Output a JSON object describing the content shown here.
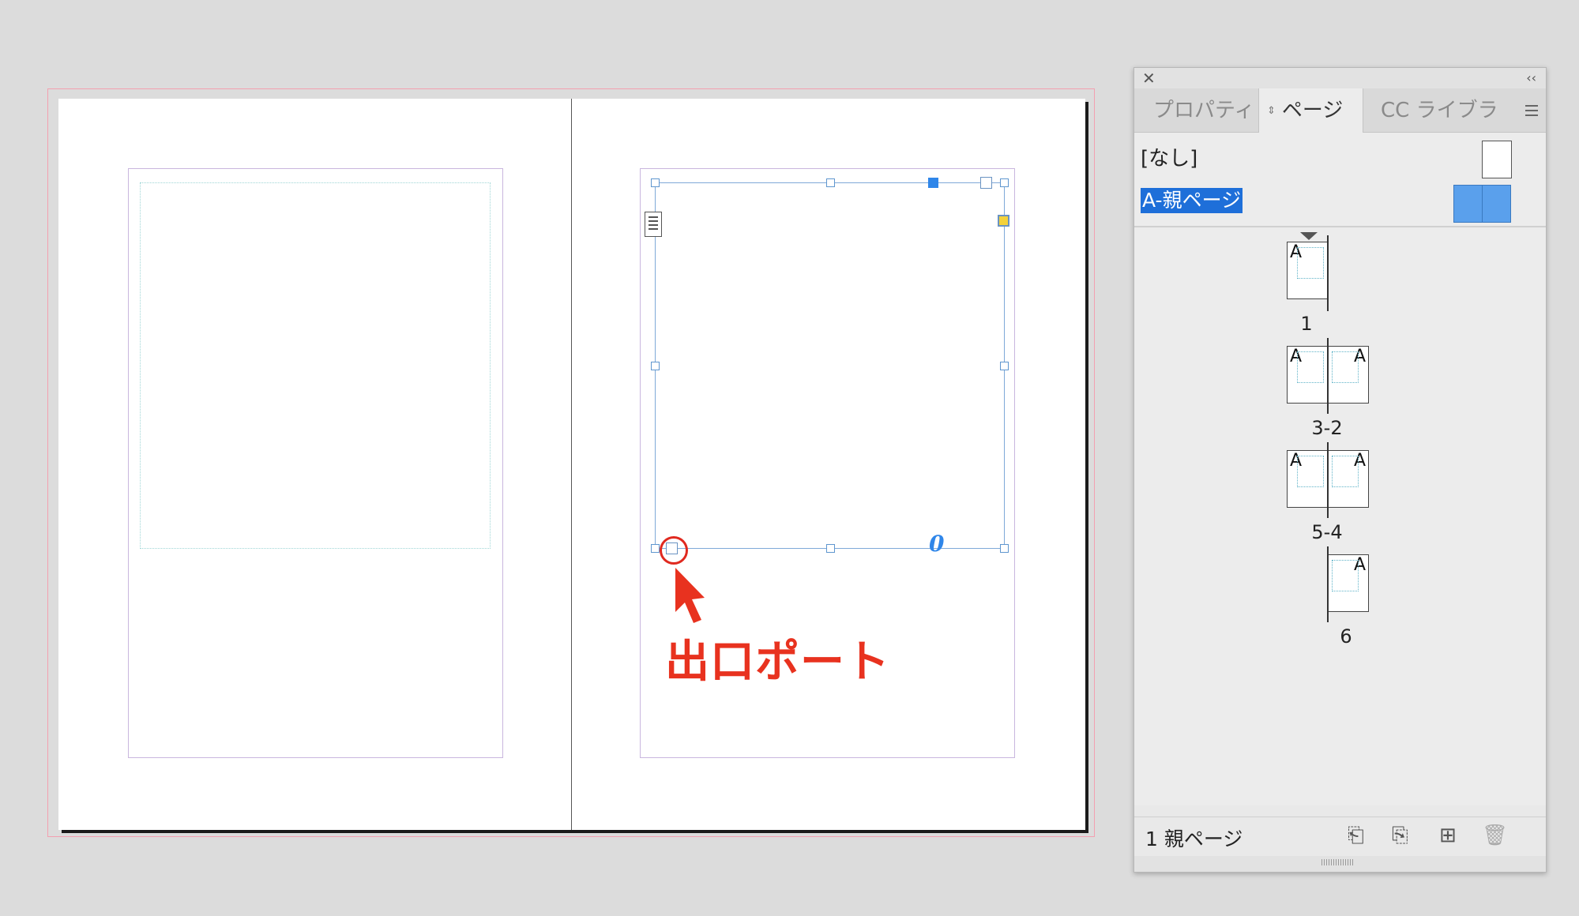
{
  "annotation": {
    "label": "出口ポート",
    "color": "#e8321f"
  },
  "text_frame": {
    "overflow_marker": "0"
  },
  "panel": {
    "tabs": [
      {
        "label": "プロパティ"
      },
      {
        "label": "ページ",
        "active": true
      },
      {
        "label": "CC ライブラ"
      }
    ],
    "parent_pages": [
      {
        "label": "[なし]"
      },
      {
        "label": "A-親ページ",
        "selected": true
      }
    ],
    "pages": [
      {
        "number": "1",
        "prefix": "A"
      },
      {
        "number": "3-2",
        "prefix": "A"
      },
      {
        "number": "5-4",
        "prefix": "A"
      },
      {
        "number": "6",
        "prefix": "A"
      }
    ],
    "footer": {
      "status": "1 親ページ"
    },
    "icons": [
      "close-icon",
      "collapse-icon",
      "panel-menu-icon",
      "edit-page-size-icon",
      "new-spread-icon",
      "new-page-icon",
      "trash-icon"
    ],
    "accent_color": "#1e6fd9"
  }
}
